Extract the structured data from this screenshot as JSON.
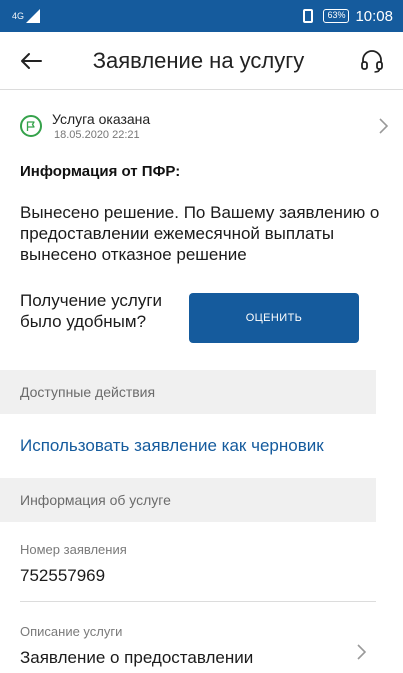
{
  "status_bar": {
    "network": "4G",
    "battery": "63%",
    "time": "10:08"
  },
  "appbar": {
    "title": "Заявление на услугу",
    "back_icon": "arrow-left-icon",
    "support_icon": "headset-icon"
  },
  "service_status": {
    "title": "Услуга оказана",
    "date": "18.05.2020 22:21",
    "status_color": "#35a24b"
  },
  "pfr_info": {
    "heading": "Информация от ПФР:",
    "text": "Вынесено решение. По Вашему заявлению о предоставлении ежемесячной выплаты вынесено отказное решение"
  },
  "rating": {
    "question": "Получение услуги было удобным?",
    "button_label": "ОЦЕНИТЬ"
  },
  "actions": {
    "section_title": "Доступные действия",
    "use_as_draft": "Использовать заявление как черновик"
  },
  "service_info": {
    "section_title": "Информация об услуге",
    "number_label": "Номер заявления",
    "number_value": "752557969",
    "description_label": "Описание услуги",
    "description_value": "Заявление о предоставлении"
  },
  "colors": {
    "primary": "#155b9d",
    "section_bg": "#f0f0f0"
  }
}
